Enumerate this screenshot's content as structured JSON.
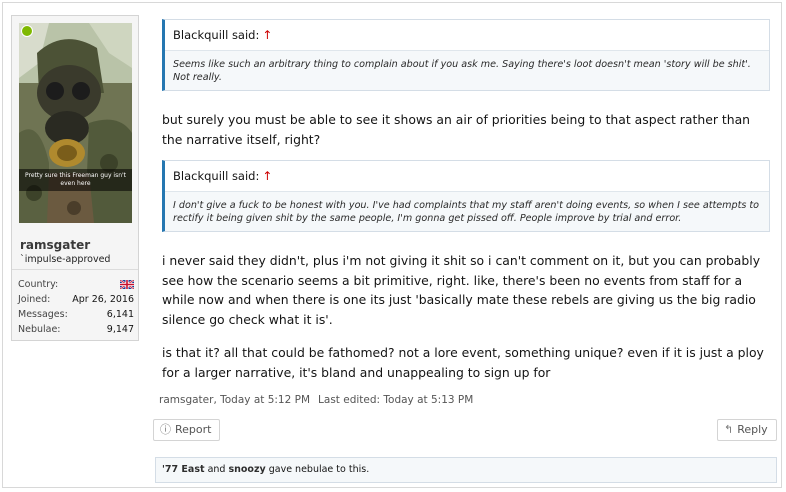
{
  "user": {
    "name": "ramsgater",
    "title": "`impulse-approved",
    "avatar_caption": "Pretty sure this Freeman guy isn't even here",
    "stats": [
      {
        "label": "Country:",
        "value": ""
      },
      {
        "label": "Joined:",
        "value": "Apr 26, 2016"
      },
      {
        "label": "Messages:",
        "value": "6,141"
      },
      {
        "label": "Nebulae:",
        "value": "9,147"
      }
    ],
    "online_color": "#7fb900"
  },
  "quotes": [
    {
      "author": "Blackquill said:",
      "arrow": "↑",
      "text": "Seems like such an arbitrary thing to complain about if you ask me. Saying there's loot doesn't mean 'story will be shit'. Not really."
    },
    {
      "author": "Blackquill said:",
      "arrow": "↑",
      "text": "I don't give a fuck to be honest with you. I've had complaints that my staff aren't doing events, so when I see attempts to rectify it being given shit by the same people, I'm gonna get pissed off. People improve by trial and error."
    }
  ],
  "message": {
    "p1": "but surely you must be able to see it shows an air of priorities being to that aspect rather than the narrative itself, right?",
    "p2": "i never said they didn't, plus i'm not giving it shit so i can't comment on it, but you can probably see how the scenario seems a bit primitive, right. like, there's been no events from staff for a while now and when there is one its just 'basically mate these rebels are giving us the big radio silence go check what it is'.",
    "p3": "is that it? all that could be fathomed? not a lore event, something unique? even if it is just a ploy for a larger narrative, it's bland and unappealing to sign up for"
  },
  "meta": {
    "posted": "ramsgater, Today at 5:12 PM",
    "edited": "Last edited: Today at 5:13 PM"
  },
  "actions": {
    "report_label": "Report",
    "reply_label": "Reply"
  },
  "likes": {
    "user1": "'77 East",
    "and": "and",
    "user2": "snoozy",
    "suffix": "gave nebulae to this."
  },
  "colors": {
    "quote_border": "#2577b1",
    "arrow": "#cc0000"
  }
}
